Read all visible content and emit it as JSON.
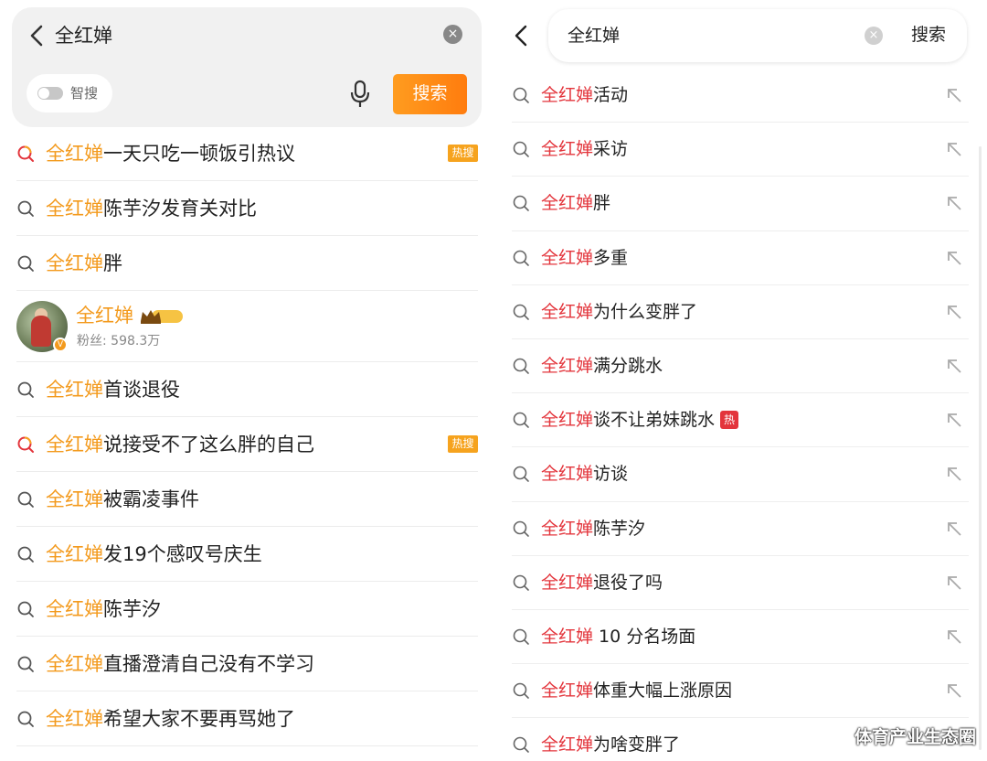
{
  "left": {
    "query": "全红婵",
    "clear_icon": "×",
    "smart_search_label": "智搜",
    "search_button": "搜索",
    "items": [
      {
        "hl": "全红婵",
        "rest": "一天只吃一顿饭引热议",
        "badge": "热搜",
        "hot_icon": true
      },
      {
        "hl": "全红婵",
        "rest": "陈芋汐发育关对比",
        "badge": "",
        "hot_icon": false
      },
      {
        "hl": "全红婵",
        "rest": "胖",
        "badge": "",
        "hot_icon": false
      }
    ],
    "user": {
      "name": "全红婵",
      "crown_level": "II",
      "fans": "粉丝: 598.3万",
      "verified": "V"
    },
    "items2": [
      {
        "hl": "全红婵",
        "rest": "首谈退役",
        "badge": "",
        "hot_icon": false
      },
      {
        "hl": "全红婵",
        "rest": "说接受不了这么胖的自己",
        "badge": "热搜",
        "hot_icon": true
      },
      {
        "hl": "全红婵",
        "rest": "被霸凌事件",
        "badge": "",
        "hot_icon": false
      },
      {
        "hl": "全红婵",
        "rest": "发19个感叹号庆生",
        "badge": "",
        "hot_icon": false
      },
      {
        "hl": "全红婵",
        "rest": "陈芋汐",
        "badge": "",
        "hot_icon": false
      },
      {
        "hl": "全红婵",
        "rest": "直播澄清自己没有不学习",
        "badge": "",
        "hot_icon": false
      },
      {
        "hl": "全红婵",
        "rest": "希望大家不要再骂她了",
        "badge": "",
        "hot_icon": false
      }
    ],
    "colors": {
      "highlight": "#f39a1d",
      "badge": "#f6a31e",
      "button": "#ff8c15"
    }
  },
  "right": {
    "query": "全红婵",
    "clear_icon": "×",
    "search_button": "搜索",
    "hot_label": "热",
    "items": [
      {
        "hl": "全红婵",
        "rest": "活动",
        "hot": false
      },
      {
        "hl": "全红婵",
        "rest": "采访",
        "hot": false
      },
      {
        "hl": "全红婵",
        "rest": "胖",
        "hot": false
      },
      {
        "hl": "全红婵",
        "rest": "多重",
        "hot": false
      },
      {
        "hl": "全红婵",
        "rest": "为什么变胖了",
        "hot": false
      },
      {
        "hl": "全红婵",
        "rest": "满分跳水",
        "hot": false
      },
      {
        "hl": "全红婵",
        "rest": "谈不让弟妹跳水",
        "hot": true
      },
      {
        "hl": "全红婵",
        "rest": "访谈",
        "hot": false
      },
      {
        "hl": "全红婵",
        "rest": "陈芋汐",
        "hot": false
      },
      {
        "hl": "全红婵",
        "rest": "退役了吗",
        "hot": false
      },
      {
        "hl": "全红婵",
        "rest": " 10 分名场面",
        "hot": false
      },
      {
        "hl": "全红婵",
        "rest": "体重大幅上涨原因",
        "hot": false
      },
      {
        "hl": "全红婵",
        "rest": "为啥变胖了",
        "hot": false
      }
    ],
    "colors": {
      "highlight": "#e3353c"
    }
  },
  "watermark": "体育产业生态圈"
}
